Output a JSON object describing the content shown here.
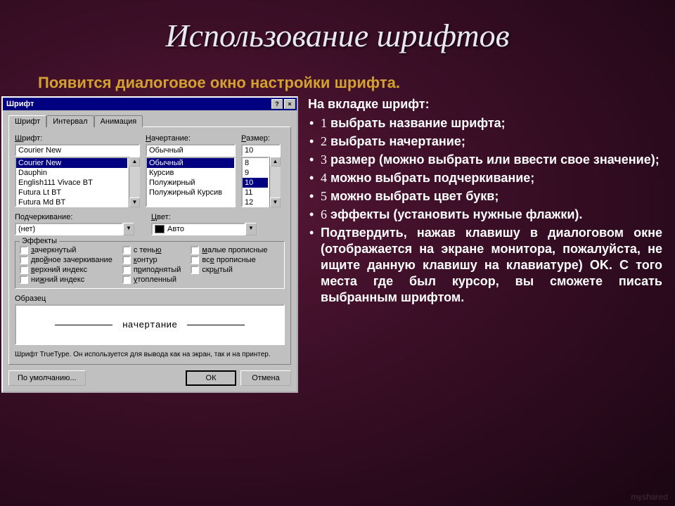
{
  "slide": {
    "title": "Использование шрифтов",
    "subtitle": "Появится диалоговое окно настройки шрифта.",
    "rhs_heading": "На вкладке шрифт:",
    "items": [
      {
        "num": "1",
        "text": " выбрать название шрифта;"
      },
      {
        "num": "2",
        "text": " выбрать начертание;"
      },
      {
        "num": "3",
        "text": " размер (можно выбрать или ввести свое значение);"
      },
      {
        "num": "4",
        "text": " можно выбрать подчеркивание;"
      },
      {
        "num": "5",
        "text": " можно выбрать цвет букв;"
      },
      {
        "num": "6",
        "text": " эффекты (установить нужные флажки)."
      }
    ],
    "final": "Подтвердить, нажав клавишу в диалоговом окне (отображается на экране монитора, пожалуйста, не ищите данную клавишу на клавиатуре) OK. С того места где был курсор, вы сможете писать выбранным шрифтом."
  },
  "dialog": {
    "title": "Шрифт",
    "help": "?",
    "close": "×",
    "tabs": {
      "t1": "Шрифт",
      "t2": "Интервал",
      "t3": "Анимация"
    },
    "labels": {
      "font": "Шрифт:",
      "style": "Начертание:",
      "size": "Размер:",
      "underline": "Подчеркивание:",
      "color": "Цвет:",
      "effects": "Эффекты",
      "sample": "Образец"
    },
    "font_value": "Courier New",
    "font_list": [
      "Courier New",
      "Dauphin",
      "English111 Vivace BT",
      "Futura Lt BT",
      "Futura Md BT"
    ],
    "font_sel": 0,
    "style_value": "Обычный",
    "style_list": [
      "Обычный",
      "Курсив",
      "Полужирный",
      "Полужирный Курсив"
    ],
    "style_sel": 0,
    "size_value": "10",
    "size_list": [
      "8",
      "9",
      "10",
      "11",
      "12"
    ],
    "size_sel": 2,
    "underline_value": "(нет)",
    "color_value": "Авто",
    "effects_col1": [
      "зачеркнутый",
      "двойное зачеркивание",
      "верхний индекс",
      "нижний индекс"
    ],
    "effects_col2": [
      "с тенью",
      "контур",
      "приподнятый",
      "утопленный"
    ],
    "effects_col3": [
      "малые прописные",
      "все прописные",
      "скрытый"
    ],
    "sample_text": "начертание",
    "hint": "Шрифт TrueType. Он используется для вывода как на экран, так и на принтер.",
    "buttons": {
      "default": "По умолчанию...",
      "ok": "ОК",
      "cancel": "Отмена"
    }
  },
  "watermark": "myshared"
}
